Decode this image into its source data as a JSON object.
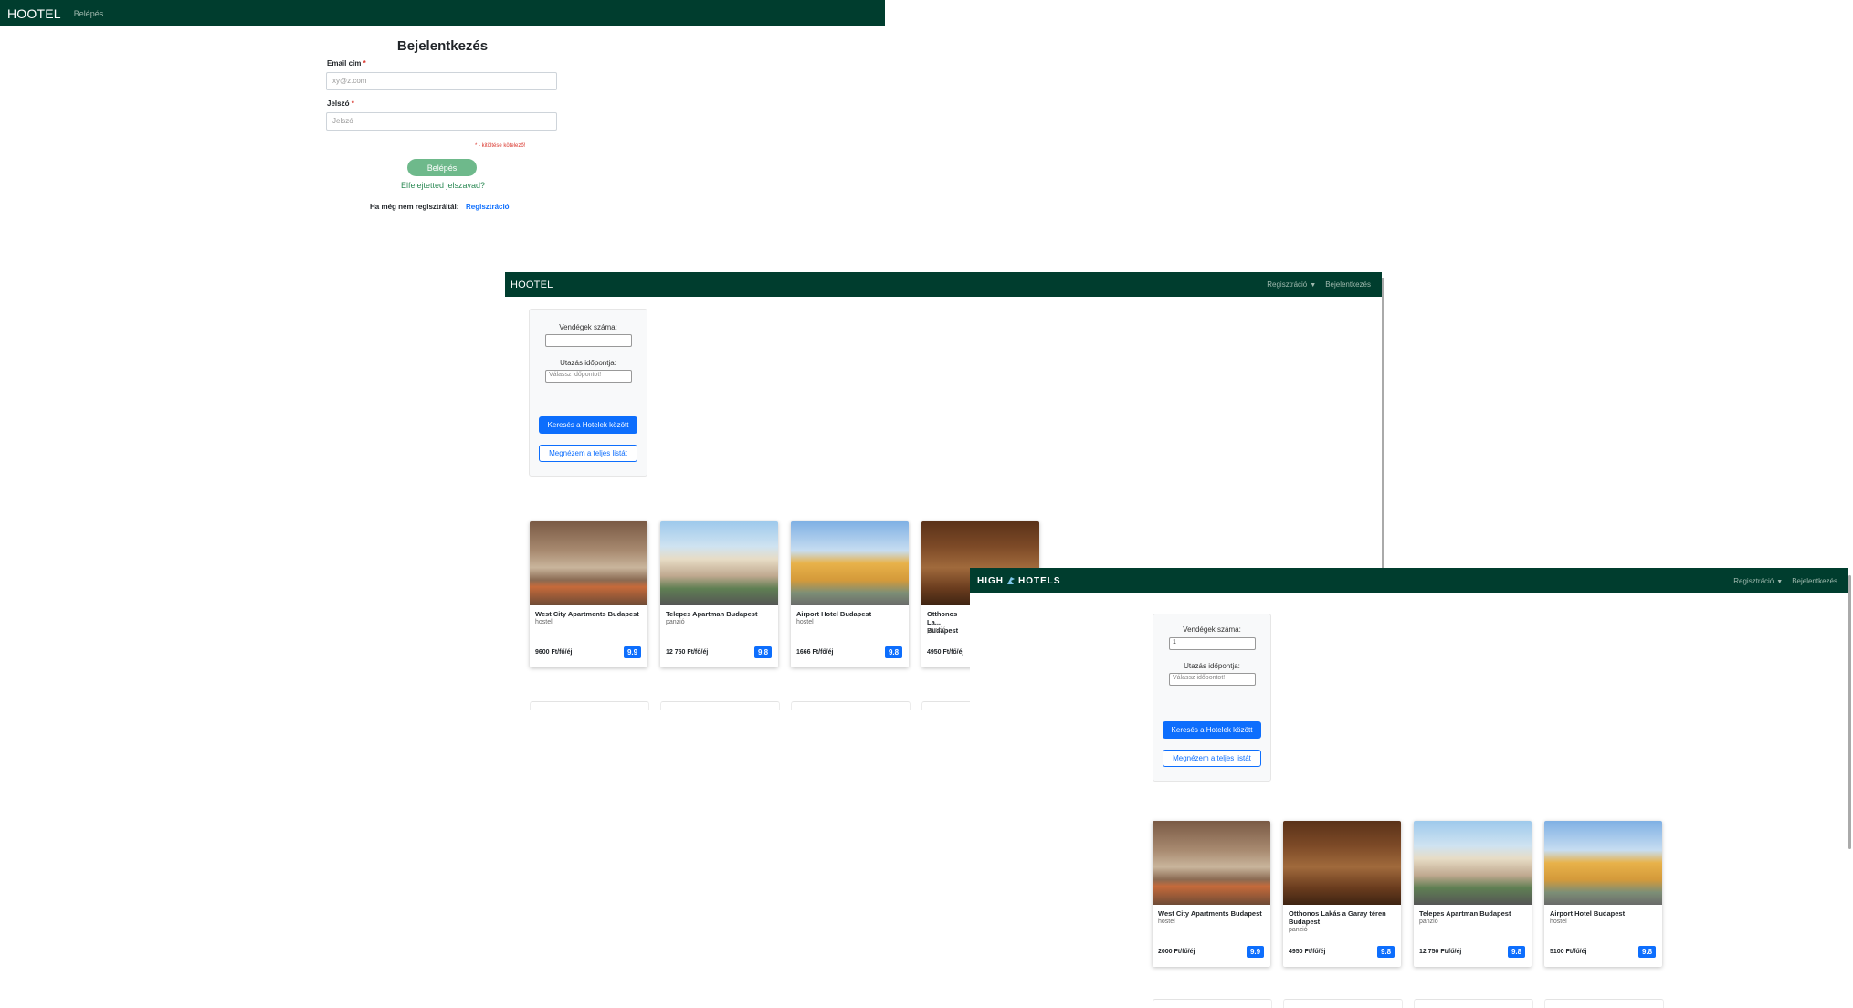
{
  "login": {
    "nav": {
      "brand": "HOOTEL",
      "link": "Belépés"
    },
    "title": "Bejelentkezés",
    "email_label": "Email cím",
    "email_placeholder": "xy@z.com",
    "password_label": "Jelszó",
    "password_placeholder": "Jelszó",
    "required_marker": "*",
    "required_note": "* - kitöltése kötelező!",
    "submit_label": "Belépés",
    "forgot_label": "Elfelejtetted jelszavad?",
    "register_prompt": "Ha még nem regisztráltál:",
    "register_link": "Regisztráció"
  },
  "window1": {
    "nav": {
      "brand": "HOOTEL",
      "register": "Regisztráció",
      "login": "Bejelentkezés"
    },
    "search": {
      "guests_label": "Vendégek száma:",
      "guests_value": "",
      "date_label": "Utazás időpontja:",
      "date_placeholder": "Válassz időpontot!",
      "search_button": "Keresés a Hotelek között",
      "list_button": "Megnézem a teljes listát"
    },
    "cards": [
      {
        "name": "West City Apartments Budapest",
        "type": "hostel",
        "price": "9600 Ft/fő/éj",
        "rating": "9.9"
      },
      {
        "name": "Telepes Apartman Budapest",
        "type": "panzió",
        "price": "12 750 Ft/fő/éj",
        "rating": "9.8"
      },
      {
        "name": "Airport Hotel Budapest",
        "type": "hostel",
        "price": "1666 Ft/fő/éj",
        "rating": "9.8"
      },
      {
        "name": "Otthonos Lakás a Garay téren Budapest",
        "name_visible": "Otthonos La... Budapest",
        "type": "panzió",
        "price": "4950 Ft/fő/éj",
        "rating": ""
      }
    ]
  },
  "window2": {
    "nav": {
      "brand_left": "HIGH",
      "brand_right": "HOTELS",
      "register": "Regisztráció",
      "login": "Bejelentkezés"
    },
    "search": {
      "guests_label": "Vendégek száma:",
      "guests_value": "1",
      "date_label": "Utazás időpontja:",
      "date_placeholder": "Válassz időpontot!",
      "search_button": "Keresés a Hotelek között",
      "list_button": "Megnézem a teljes listát"
    },
    "cards": [
      {
        "name": "West City Apartments Budapest",
        "type": "hostel",
        "price": "2000 Ft/fő/éj",
        "rating": "9.9"
      },
      {
        "name": "Otthonos Lakás a Garay téren Budapest",
        "type": "panzió",
        "price": "4950 Ft/fő/éj",
        "rating": "9.8"
      },
      {
        "name": "Telepes Apartman Budapest",
        "type": "panzió",
        "price": "12 750 Ft/fő/éj",
        "rating": "9.8"
      },
      {
        "name": "Airport Hotel Budapest",
        "type": "hostel",
        "price": "5100 Ft/fő/éj",
        "rating": "9.8"
      }
    ]
  },
  "colors": {
    "nav_bg": "#003d2e",
    "primary": "#0d6efd",
    "login_button": "#6eb98b",
    "required": "#d9342b"
  }
}
